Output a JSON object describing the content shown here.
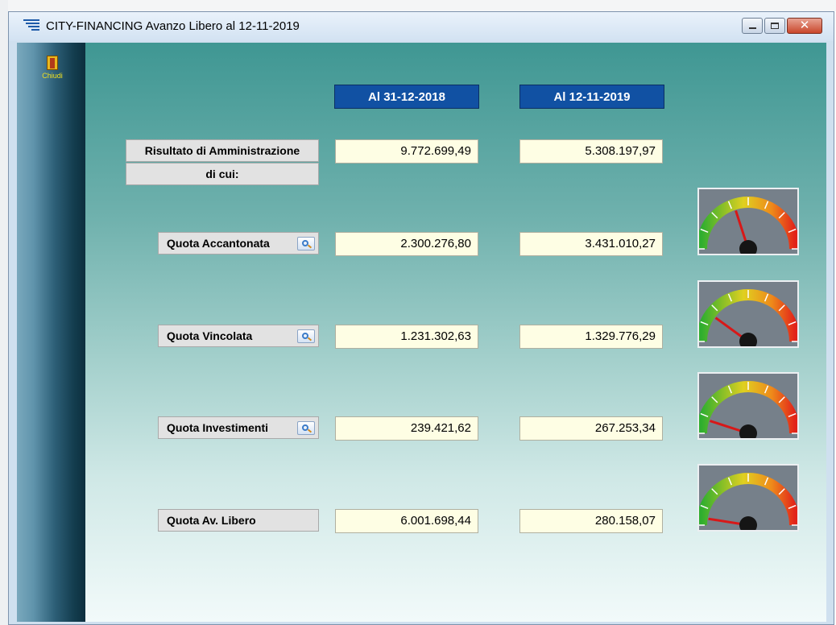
{
  "window": {
    "title": "CITY-FINANCING  Avanzo Libero al 12-11-2019",
    "minimize": "minimize",
    "maximize": "maximize",
    "close": "close"
  },
  "toolbar": {
    "close_label": "Chiudi"
  },
  "headers": {
    "col1": "Al  31-12-2018",
    "col2": "Al  12-11-2019"
  },
  "rows": [
    {
      "label": "Risultato di Amministrazione",
      "val1": "9.772.699,49",
      "val2": "5.308.197,97"
    },
    {
      "label": "di cui:"
    },
    {
      "label": "Quota Accantonata",
      "val1": "2.300.276,80",
      "val2": "3.431.010,27",
      "gauge_level": 0.4
    },
    {
      "label": "Quota Vincolata",
      "val1": "1.231.302,63",
      "val2": "1.329.776,29",
      "gauge_level": 0.2
    },
    {
      "label": "Quota Investimenti",
      "val1": "239.421,62",
      "val2": "267.253,34",
      "gauge_level": 0.1
    },
    {
      "label": "Quota Av. Libero",
      "val1": "6.001.698,44",
      "val2": "280.158,07",
      "gauge_level": 0.05
    }
  ],
  "icons": {
    "app": "list-icon",
    "close_door": "exit-door-icon",
    "detail": "magnifier-icon",
    "gauge": "speedometer-gauge"
  },
  "colors": {
    "header_bg": "#1151a3",
    "value_bg": "#fefee4",
    "title_text": "#000000"
  }
}
